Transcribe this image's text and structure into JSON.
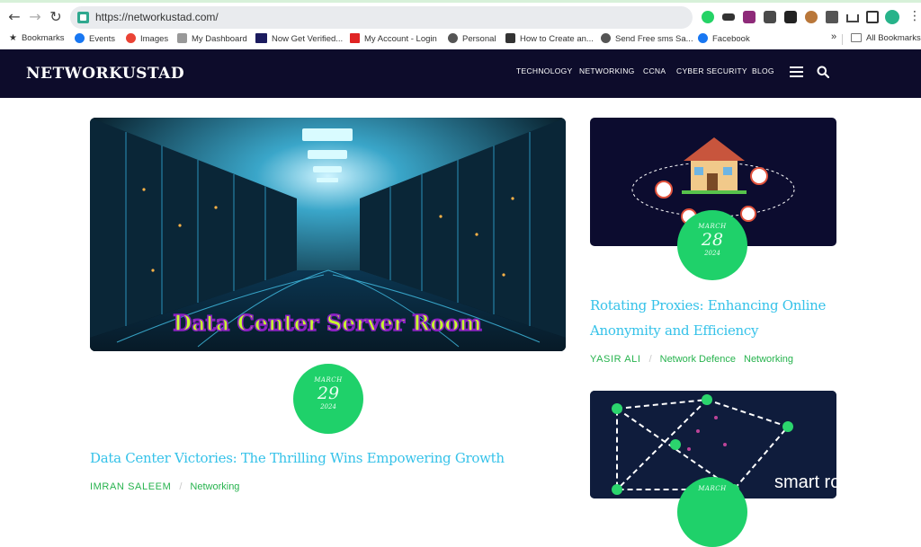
{
  "browser": {
    "url": "https://networkustad.com/",
    "bookmarks": [
      {
        "label": "Bookmarks",
        "icon": "star-icon"
      },
      {
        "label": "Events",
        "icon": "facebook-icon"
      },
      {
        "label": "Images",
        "icon": "google-icon"
      },
      {
        "label": "My Dashboard",
        "icon": "dashboard-icon"
      },
      {
        "label": "Now Get Verified...",
        "icon": "hd-icon"
      },
      {
        "label": "My Account - Login",
        "icon": "account-icon"
      },
      {
        "label": "Personal",
        "icon": "globe-icon"
      },
      {
        "label": "How to Create an...",
        "icon": "sd-icon"
      },
      {
        "label": "Send Free sms Sa...",
        "icon": "globe-icon"
      },
      {
        "label": "Facebook",
        "icon": "facebook-icon"
      }
    ],
    "overflow": "»",
    "all_bookmarks": "All Bookmarks"
  },
  "site": {
    "logo": "NETWORKUSTAD",
    "menu": [
      "TECHNOLOGY",
      "NETWORKING",
      "CCNA",
      "CYBER SECURITY",
      "BLOG"
    ]
  },
  "posts": {
    "main": {
      "image_caption": "Data Center Server Room",
      "date": {
        "month": "MARCH",
        "day": "29",
        "year": "2024"
      },
      "title": "Data Center Victories: The Thrilling Wins Empowering Growth",
      "author": "IMRAN SALEEM",
      "tags": [
        "Networking"
      ]
    },
    "side1": {
      "date": {
        "month": "MARCH",
        "day": "28",
        "year": "2024"
      },
      "title": "Rotating Proxies: Enhancing Online Anonymity and Efficiency",
      "author": "YASIR ALI",
      "tags": [
        "Network Defence",
        "Networking"
      ]
    },
    "side2": {
      "image_caption": "smart routing",
      "date": {
        "month": "MARCH"
      }
    }
  },
  "colors": {
    "header_bg": "#0d0c2b",
    "accent_green": "#1fd16a",
    "title_blue": "#35c2e9",
    "meta_green": "#27b34e"
  }
}
